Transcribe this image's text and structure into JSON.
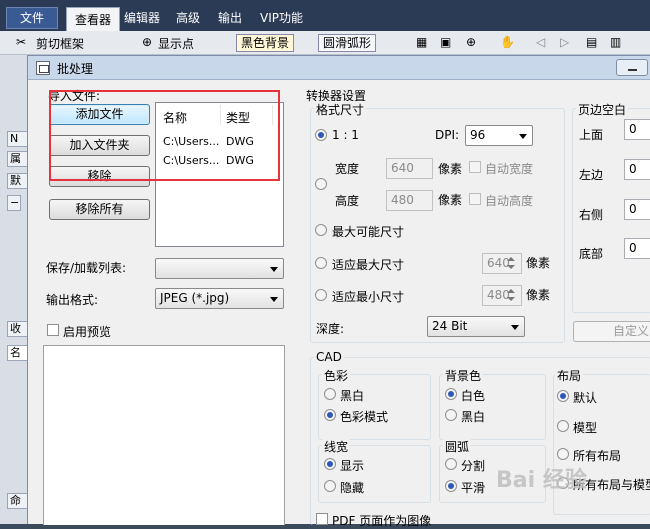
{
  "menubar": {
    "file": "文件",
    "tabs": [
      "查看器",
      "编辑器",
      "高级",
      "输出",
      "VIP功能"
    ],
    "active_tab": "查看器"
  },
  "ribbon": {
    "trim_frame": "剪切框架",
    "show_points": "显示点",
    "black_background": "黑色背景",
    "smooth_arc": "圆滑弧形"
  },
  "side_panel": {
    "tabs": [
      "N",
      "属",
      "默",
      "收",
      "名",
      "命"
    ]
  },
  "dialog": {
    "title": "批处理",
    "import_files_label": "导入文件:",
    "buttons": {
      "add_file": "添加文件",
      "add_folder": "加入文件夹",
      "remove": "移除",
      "remove_all": "移除所有"
    },
    "file_table": {
      "columns": [
        "名称",
        "类型"
      ],
      "rows": [
        {
          "name": "C:\\Users...",
          "type": "DWG"
        },
        {
          "name": "C:\\Users...",
          "type": "DWG"
        }
      ]
    },
    "save_load_list_label": "保存/加载列表:",
    "save_load_list_value": "",
    "output_format_label": "输出格式:",
    "output_format_value": "JPEG (*.jpg)",
    "enable_preview": "启用预览",
    "converter": {
      "title": "转换器设置",
      "format_size": {
        "title": "格式尺寸",
        "ratio": "1 : 1",
        "dpi_label": "DPI:",
        "dpi_value": "96",
        "width_label": "宽度",
        "width_value": "640",
        "height_label": "高度",
        "height_value": "480",
        "pixels": "像素",
        "auto_width": "自动宽度",
        "auto_height": "自动高度",
        "max_possible": "最大可能尺寸",
        "fit_max": "适应最大尺寸",
        "fit_max_value": "640",
        "fit_min": "适应最小尺寸",
        "fit_min_value": "480",
        "depth_label": "深度:",
        "depth_value": "24 Bit"
      },
      "margins": {
        "title": "页边空白",
        "top": "上面",
        "left": "左边",
        "right": "右侧",
        "bottom": "底部",
        "top_value": "0",
        "left_value": "0",
        "right_value": "0",
        "bottom_value": "0",
        "custom_button": "自定义"
      }
    },
    "cad": {
      "title": "CAD",
      "color": {
        "title": "色彩",
        "options": [
          "黑白",
          "色彩模式"
        ],
        "selected": 1
      },
      "background": {
        "title": "背景色",
        "options": [
          "白色",
          "黑白"
        ],
        "selected": 0
      },
      "layout": {
        "title": "布局",
        "options": [
          "默认",
          "模型",
          "所有布局",
          "所有布局与模型"
        ],
        "selected": 0
      },
      "linewidth": {
        "title": "线宽",
        "options": [
          "显示",
          "隐藏"
        ],
        "selected": 0
      },
      "arc": {
        "title": "圆弧",
        "options": [
          "分割",
          "平滑"
        ],
        "selected": 1
      },
      "pdf_page_as_image": "PDF 页面作为图像"
    }
  },
  "watermark": "Bai 经验"
}
